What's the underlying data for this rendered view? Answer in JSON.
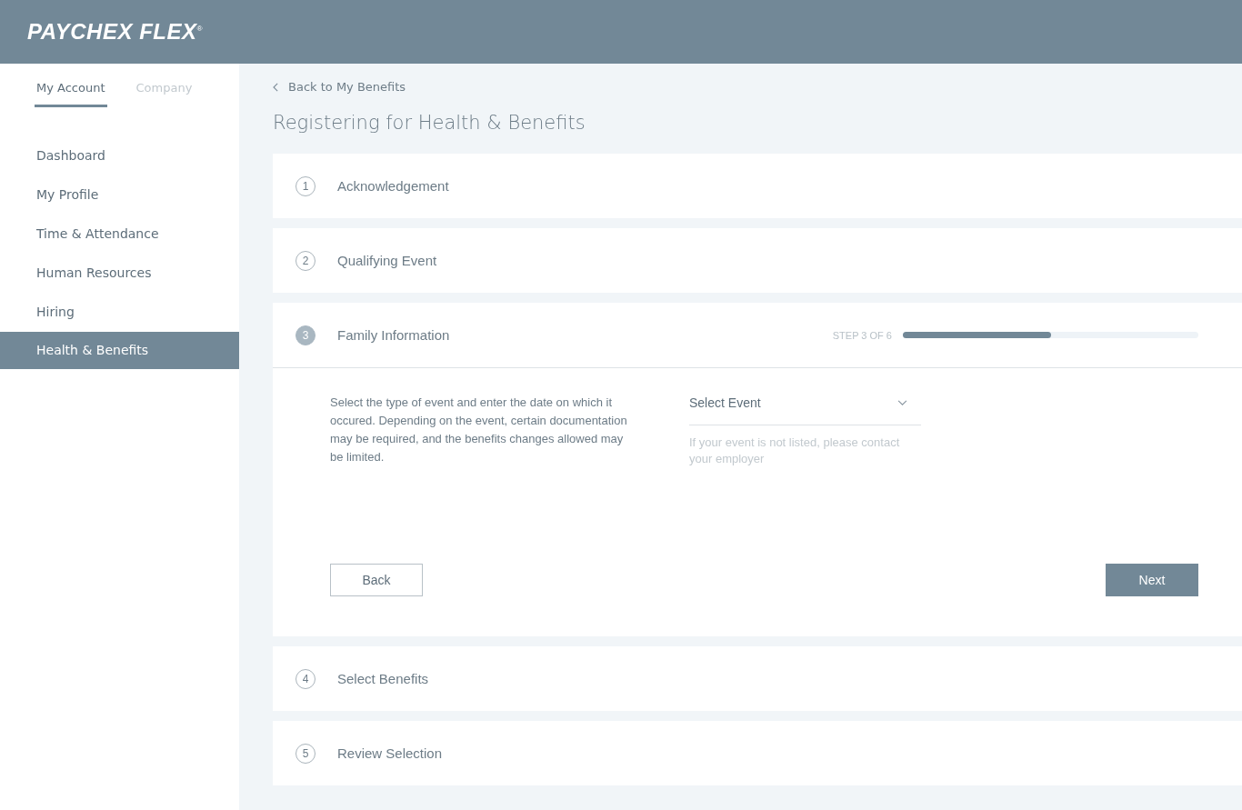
{
  "logo": "PAYCHEX FLEX$^{®}$",
  "account_tabs": [
    {
      "label": "My Account",
      "selected": true
    },
    {
      "label": "Company",
      "selected": false
    }
  ],
  "sidebar": {
    "items": [
      {
        "label": "Dashboard",
        "selected": false
      },
      {
        "label": "My Profile",
        "selected": false
      },
      {
        "label": "Time & Attendance",
        "selected": false
      },
      {
        "label": "Human Resources",
        "selected": false
      },
      {
        "label": "Hiring",
        "selected": false
      },
      {
        "label": "Health & Benefits",
        "selected": true
      }
    ]
  },
  "back_link": "Back to My Benefits",
  "page_title": "Registering for Health & Benefits",
  "steps": [
    {
      "number": "1",
      "title": "Acknowledgement",
      "expanded": false
    },
    {
      "number": "2",
      "title": "Qualifying Event",
      "expanded": false
    },
    {
      "number": "3",
      "title": "Family Information",
      "expanded": true,
      "progress_label": "STEP 3 OF 6",
      "level": 0.5,
      "description": "Select the type of event and enter the date on which it occured. Depending on the event, certain documentation may be required, and the benefits changes allowed may be limited.",
      "select": {
        "placeholder": "Select Event",
        "hint": "If your event is not listed, please contact your employer"
      },
      "buttons": [
        "Back",
        "Next"
      ]
    },
    {
      "number": "4",
      "title": "Select Benefits",
      "expanded": false
    },
    {
      "number": "5",
      "title": "Review Selection",
      "expanded": false
    }
  ]
}
